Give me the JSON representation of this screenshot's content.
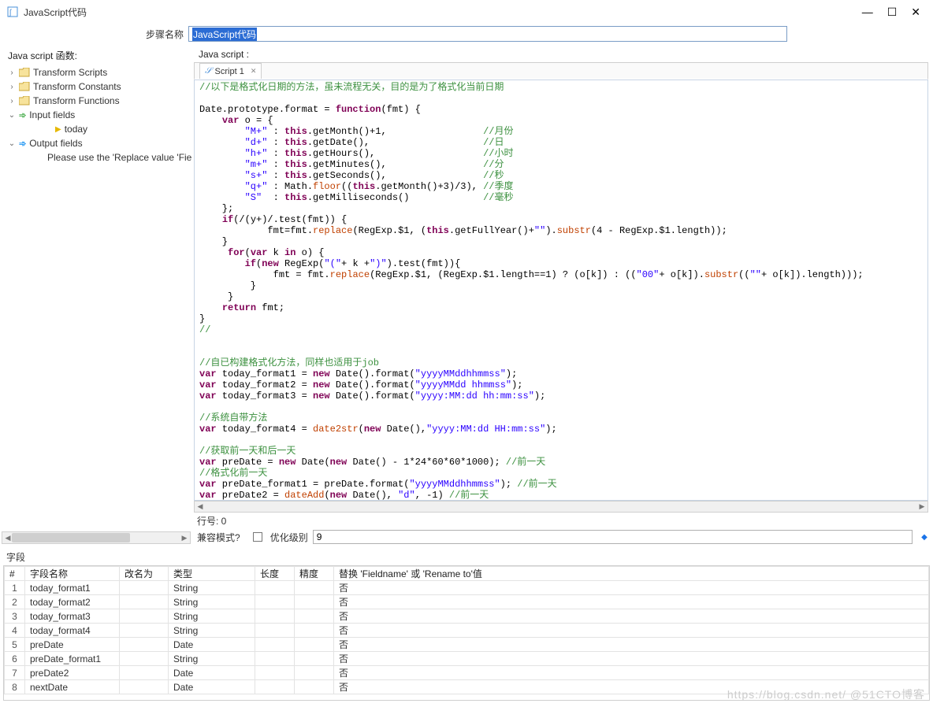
{
  "window": {
    "title": "JavaScript代码",
    "step_label": "步骤名称",
    "step_value": "JavaScript代码"
  },
  "labels": {
    "left_header": "Java script 函数:",
    "right_header": "Java script :",
    "line_no": "行号: 0",
    "compat": "兼容模式?",
    "opt_level": "优化级别",
    "opt_value": "9",
    "fields_section": "字段"
  },
  "tree": {
    "items": [
      {
        "label": "Transform Scripts",
        "icon": "folder",
        "arrow": ">",
        "lvl": 0
      },
      {
        "label": "Transform Constants",
        "icon": "folder",
        "arrow": ">",
        "lvl": 0
      },
      {
        "label": "Transform Functions",
        "icon": "folder",
        "arrow": ">",
        "lvl": 0
      },
      {
        "label": "Input fields",
        "icon": "input",
        "arrow": "v",
        "lvl": 0
      },
      {
        "label": "today",
        "icon": "play",
        "arrow": "",
        "lvl": 2
      },
      {
        "label": "Output fields",
        "icon": "output",
        "arrow": "v",
        "lvl": 0
      },
      {
        "label": "Please use the 'Replace value 'Fieldname'",
        "icon": "",
        "arrow": "",
        "lvl": 2
      }
    ]
  },
  "tab": {
    "label": "Script 1"
  },
  "code_html": "<span class='c-comment'>//以下是格式化日期的方法，虽未流程无关，目的是为了格式化当前日期</span>\n\nDate.prototype.format = <span class='c-kw'>function</span>(fmt) {\n    <span class='c-kw'>var</span> o = {\n        <span class='c-str'>\"M+\"</span> : <span class='c-kw'>this</span>.getMonth()+1,                 <span class='c-comment'>//月份</span>\n        <span class='c-str'>\"d+\"</span> : <span class='c-kw'>this</span>.getDate(),                    <span class='c-comment'>//日</span>\n        <span class='c-str'>\"h+\"</span> : <span class='c-kw'>this</span>.getHours(),                   <span class='c-comment'>//小时</span>\n        <span class='c-str'>\"m+\"</span> : <span class='c-kw'>this</span>.getMinutes(),                 <span class='c-comment'>//分</span>\n        <span class='c-str'>\"s+\"</span> : <span class='c-kw'>this</span>.getSeconds(),                 <span class='c-comment'>//秒</span>\n        <span class='c-str'>\"q+\"</span> : Math.<span class='c-fn'>floor</span>((<span class='c-kw'>this</span>.getMonth()+3)/3), <span class='c-comment'>//季度</span>\n        <span class='c-str'>\"S\"</span>  : <span class='c-kw'>this</span>.getMilliseconds()             <span class='c-comment'>//毫秒</span>\n    };\n    <span class='c-kw'>if</span>(/(y+)/.test(fmt)) {\n            fmt=fmt.<span class='c-fn'>replace</span>(RegExp.$1, (<span class='c-kw'>this</span>.getFullYear()+<span class='c-str'>\"\"</span>).<span class='c-fn'>substr</span>(4 - RegExp.$1.length));\n    }\n     <span class='c-kw'>for</span>(<span class='c-kw'>var</span> k <span class='c-kw'>in</span> o) {\n        <span class='c-kw'>if</span>(<span class='c-kw'>new</span> RegExp(<span class='c-str'>\"(\"</span>+ k +<span class='c-str'>\")\"</span>).test(fmt)){\n             fmt = fmt.<span class='c-fn'>replace</span>(RegExp.$1, (RegExp.$1.length==1) ? (o[k]) : ((<span class='c-str'>\"00\"</span>+ o[k]).<span class='c-fn'>substr</span>((<span class='c-str'>\"\"</span>+ o[k]).length)));\n         }\n     }\n    <span class='c-kw'>return</span> fmt;\n}\n<span class='c-comment'>//</span>\n\n\n<span class='c-comment'>//自已构建格式化方法，同样也适用于job</span>\n<span class='c-kw'>var</span> today_format1 = <span class='c-kw'>new</span> Date().format(<span class='c-str'>\"yyyyMMddhhmmss\"</span>);\n<span class='c-kw'>var</span> today_format2 = <span class='c-kw'>new</span> Date().format(<span class='c-str'>\"yyyyMMdd hhmmss\"</span>);\n<span class='c-kw'>var</span> today_format3 = <span class='c-kw'>new</span> Date().format(<span class='c-str'>\"yyyy:MM:dd hh:mm:ss\"</span>);\n\n<span class='c-comment'>//系统自带方法</span>\n<span class='c-kw'>var</span> today_format4 = <span class='c-fn'>date2str</span>(<span class='c-kw'>new</span> Date(),<span class='c-str'>\"yyyy:MM:dd HH:mm:ss\"</span>);\n\n<span class='c-comment'>//获取前一天和后一天</span>\n<span class='c-kw'>var</span> preDate = <span class='c-kw'>new</span> Date(<span class='c-kw'>new</span> Date() - 1*24*60*60*1000); <span class='c-comment'>//前一天</span>\n<span class='c-comment'>//格式化前一天</span>\n<span class='c-kw'>var</span> preDate_format1 = preDate.format(<span class='c-str'>\"yyyyMMddhhmmss\"</span>); <span class='c-comment'>//前一天</span>\n<span class='c-kw'>var</span> preDate2 = <span class='c-fn'>dateAdd</span>(<span class='c-kw'>new</span> Date(), <span class='c-str'>\"d\"</span>, -1) <span class='c-comment'>//前一天</span>\n\n<span class='c-comment'>//获取后一天</span>\n<span class='c-kw'>var</span> nextDate = <span class='c-fn'>dateAdd</span>(<span class='c-kw'>new</span> Date(), <span class='c-str'>\"d\"</span>, 1) <span class='c-comment'>//后一天</span>",
  "table": {
    "headers": [
      "#",
      "字段名称",
      "改名为",
      "类型",
      "长度",
      "精度",
      "替换 'Fieldname' 或 'Rename to'值"
    ],
    "rows": [
      {
        "n": "1",
        "name": "today_format1",
        "rename": "",
        "type": "String",
        "len": "",
        "prec": "",
        "repl": "否"
      },
      {
        "n": "2",
        "name": "today_format2",
        "rename": "",
        "type": "String",
        "len": "",
        "prec": "",
        "repl": "否"
      },
      {
        "n": "3",
        "name": "today_format3",
        "rename": "",
        "type": "String",
        "len": "",
        "prec": "",
        "repl": "否"
      },
      {
        "n": "4",
        "name": "today_format4",
        "rename": "",
        "type": "String",
        "len": "",
        "prec": "",
        "repl": "否"
      },
      {
        "n": "5",
        "name": "preDate",
        "rename": "",
        "type": "Date",
        "len": "",
        "prec": "",
        "repl": "否"
      },
      {
        "n": "6",
        "name": "preDate_format1",
        "rename": "",
        "type": "String",
        "len": "",
        "prec": "",
        "repl": "否"
      },
      {
        "n": "7",
        "name": "preDate2",
        "rename": "",
        "type": "Date",
        "len": "",
        "prec": "",
        "repl": "否"
      },
      {
        "n": "8",
        "name": "nextDate",
        "rename": "",
        "type": "Date",
        "len": "",
        "prec": "",
        "repl": "否"
      }
    ]
  },
  "watermark": "https://blog.csdn.net/ @51CTO博客"
}
